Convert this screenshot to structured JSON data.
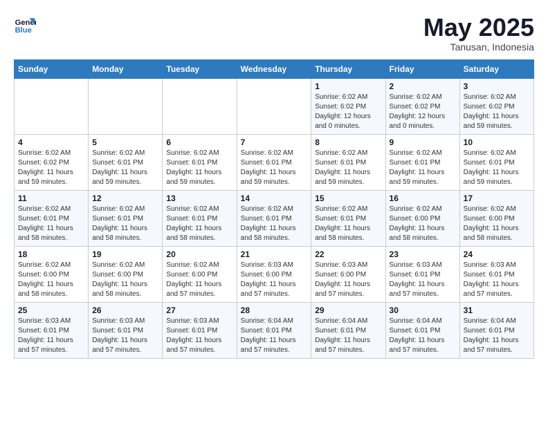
{
  "header": {
    "logo_line1": "General",
    "logo_line2": "Blue",
    "month_title": "May 2025",
    "subtitle": "Tanusan, Indonesia"
  },
  "weekdays": [
    "Sunday",
    "Monday",
    "Tuesday",
    "Wednesday",
    "Thursday",
    "Friday",
    "Saturday"
  ],
  "weeks": [
    [
      {
        "day": "",
        "info": ""
      },
      {
        "day": "",
        "info": ""
      },
      {
        "day": "",
        "info": ""
      },
      {
        "day": "",
        "info": ""
      },
      {
        "day": "1",
        "info": "Sunrise: 6:02 AM\nSunset: 6:02 PM\nDaylight: 12 hours\nand 0 minutes."
      },
      {
        "day": "2",
        "info": "Sunrise: 6:02 AM\nSunset: 6:02 PM\nDaylight: 12 hours\nand 0 minutes."
      },
      {
        "day": "3",
        "info": "Sunrise: 6:02 AM\nSunset: 6:02 PM\nDaylight: 11 hours\nand 59 minutes."
      }
    ],
    [
      {
        "day": "4",
        "info": "Sunrise: 6:02 AM\nSunset: 6:02 PM\nDaylight: 11 hours\nand 59 minutes."
      },
      {
        "day": "5",
        "info": "Sunrise: 6:02 AM\nSunset: 6:01 PM\nDaylight: 11 hours\nand 59 minutes."
      },
      {
        "day": "6",
        "info": "Sunrise: 6:02 AM\nSunset: 6:01 PM\nDaylight: 11 hours\nand 59 minutes."
      },
      {
        "day": "7",
        "info": "Sunrise: 6:02 AM\nSunset: 6:01 PM\nDaylight: 11 hours\nand 59 minutes."
      },
      {
        "day": "8",
        "info": "Sunrise: 6:02 AM\nSunset: 6:01 PM\nDaylight: 11 hours\nand 59 minutes."
      },
      {
        "day": "9",
        "info": "Sunrise: 6:02 AM\nSunset: 6:01 PM\nDaylight: 11 hours\nand 59 minutes."
      },
      {
        "day": "10",
        "info": "Sunrise: 6:02 AM\nSunset: 6:01 PM\nDaylight: 11 hours\nand 59 minutes."
      }
    ],
    [
      {
        "day": "11",
        "info": "Sunrise: 6:02 AM\nSunset: 6:01 PM\nDaylight: 11 hours\nand 58 minutes."
      },
      {
        "day": "12",
        "info": "Sunrise: 6:02 AM\nSunset: 6:01 PM\nDaylight: 11 hours\nand 58 minutes."
      },
      {
        "day": "13",
        "info": "Sunrise: 6:02 AM\nSunset: 6:01 PM\nDaylight: 11 hours\nand 58 minutes."
      },
      {
        "day": "14",
        "info": "Sunrise: 6:02 AM\nSunset: 6:01 PM\nDaylight: 11 hours\nand 58 minutes."
      },
      {
        "day": "15",
        "info": "Sunrise: 6:02 AM\nSunset: 6:01 PM\nDaylight: 11 hours\nand 58 minutes."
      },
      {
        "day": "16",
        "info": "Sunrise: 6:02 AM\nSunset: 6:00 PM\nDaylight: 11 hours\nand 58 minutes."
      },
      {
        "day": "17",
        "info": "Sunrise: 6:02 AM\nSunset: 6:00 PM\nDaylight: 11 hours\nand 58 minutes."
      }
    ],
    [
      {
        "day": "18",
        "info": "Sunrise: 6:02 AM\nSunset: 6:00 PM\nDaylight: 11 hours\nand 58 minutes."
      },
      {
        "day": "19",
        "info": "Sunrise: 6:02 AM\nSunset: 6:00 PM\nDaylight: 11 hours\nand 58 minutes."
      },
      {
        "day": "20",
        "info": "Sunrise: 6:02 AM\nSunset: 6:00 PM\nDaylight: 11 hours\nand 57 minutes."
      },
      {
        "day": "21",
        "info": "Sunrise: 6:03 AM\nSunset: 6:00 PM\nDaylight: 11 hours\nand 57 minutes."
      },
      {
        "day": "22",
        "info": "Sunrise: 6:03 AM\nSunset: 6:00 PM\nDaylight: 11 hours\nand 57 minutes."
      },
      {
        "day": "23",
        "info": "Sunrise: 6:03 AM\nSunset: 6:01 PM\nDaylight: 11 hours\nand 57 minutes."
      },
      {
        "day": "24",
        "info": "Sunrise: 6:03 AM\nSunset: 6:01 PM\nDaylight: 11 hours\nand 57 minutes."
      }
    ],
    [
      {
        "day": "25",
        "info": "Sunrise: 6:03 AM\nSunset: 6:01 PM\nDaylight: 11 hours\nand 57 minutes."
      },
      {
        "day": "26",
        "info": "Sunrise: 6:03 AM\nSunset: 6:01 PM\nDaylight: 11 hours\nand 57 minutes."
      },
      {
        "day": "27",
        "info": "Sunrise: 6:03 AM\nSunset: 6:01 PM\nDaylight: 11 hours\nand 57 minutes."
      },
      {
        "day": "28",
        "info": "Sunrise: 6:04 AM\nSunset: 6:01 PM\nDaylight: 11 hours\nand 57 minutes."
      },
      {
        "day": "29",
        "info": "Sunrise: 6:04 AM\nSunset: 6:01 PM\nDaylight: 11 hours\nand 57 minutes."
      },
      {
        "day": "30",
        "info": "Sunrise: 6:04 AM\nSunset: 6:01 PM\nDaylight: 11 hours\nand 57 minutes."
      },
      {
        "day": "31",
        "info": "Sunrise: 6:04 AM\nSunset: 6:01 PM\nDaylight: 11 hours\nand 57 minutes."
      }
    ]
  ]
}
